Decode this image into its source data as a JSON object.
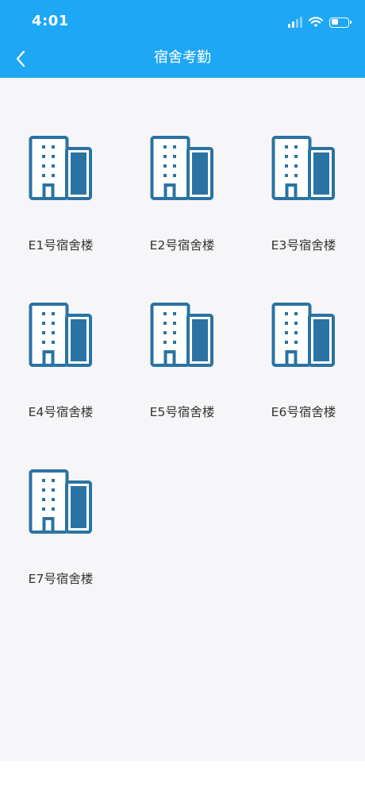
{
  "status_bar": {
    "time": "4:01",
    "icons": [
      "signal-icon",
      "wifi-icon",
      "battery-icon"
    ]
  },
  "header": {
    "title": "宿舍考勤",
    "back_icon": "back-chevron-icon",
    "background": "#1ea7f5"
  },
  "colors": {
    "accent": "#1ea7f5",
    "icon_stroke": "#2a73a3",
    "icon_fill": "#2a73a3",
    "content_bg": "#f6f6f8"
  },
  "buildings": [
    {
      "label": "E1号宿舍楼",
      "icon": "building-icon"
    },
    {
      "label": "E2号宿舍楼",
      "icon": "building-icon"
    },
    {
      "label": "E3号宿舍楼",
      "icon": "building-icon"
    },
    {
      "label": "E4号宿舍楼",
      "icon": "building-icon"
    },
    {
      "label": "E5号宿舍楼",
      "icon": "building-icon"
    },
    {
      "label": "E6号宿舍楼",
      "icon": "building-icon"
    },
    {
      "label": "E7号宿舍楼",
      "icon": "building-icon"
    }
  ]
}
